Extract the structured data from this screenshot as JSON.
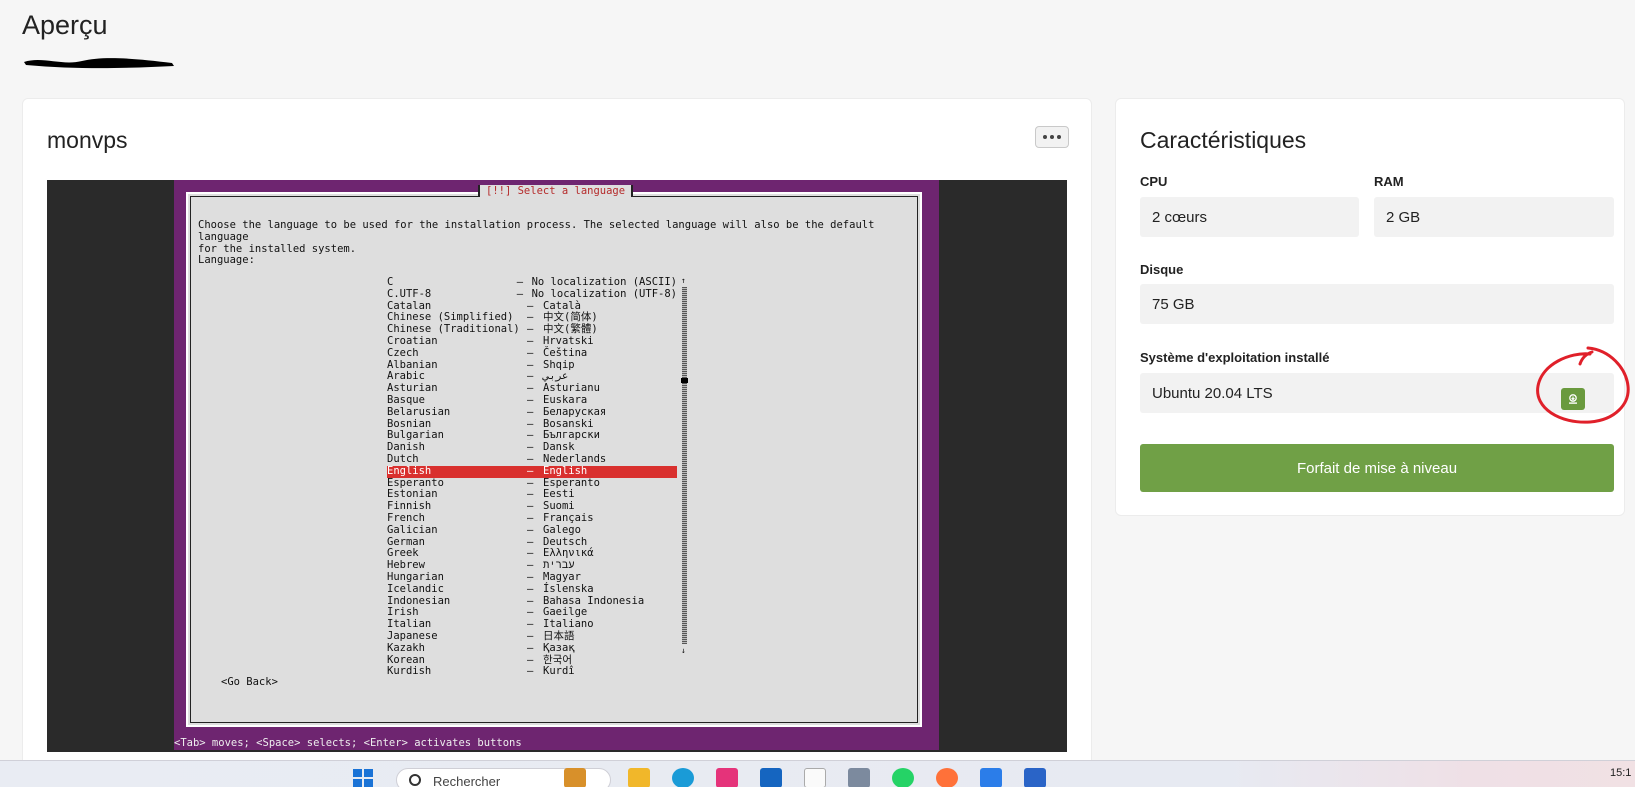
{
  "page": {
    "title": "Aperçu"
  },
  "vps": {
    "name": "monvps",
    "console": {
      "dialog_title": "[!!] Select a language",
      "intro": "Choose the language to be used for the installation process. The selected language will also be the default language\nfor the installed system.",
      "language_label": "Language:",
      "languages": [
        {
          "name": "C",
          "native": "No localization (ASCII)"
        },
        {
          "name": "C.UTF-8",
          "native": "No localization (UTF-8)"
        },
        {
          "name": "Catalan",
          "native": "Català"
        },
        {
          "name": "Chinese (Simplified)",
          "native": "中文(简体)"
        },
        {
          "name": "Chinese (Traditional)",
          "native": "中文(繁體)"
        },
        {
          "name": "Croatian",
          "native": "Hrvatski"
        },
        {
          "name": "Czech",
          "native": "Čeština"
        },
        {
          "name": "Albanian",
          "native": "Shqip"
        },
        {
          "name": "Arabic",
          "native": "عربي"
        },
        {
          "name": "Asturian",
          "native": "Asturianu"
        },
        {
          "name": "Basque",
          "native": "Euskara"
        },
        {
          "name": "Belarusian",
          "native": "Беларуская"
        },
        {
          "name": "Bosnian",
          "native": "Bosanski"
        },
        {
          "name": "Bulgarian",
          "native": "Български"
        },
        {
          "name": "Danish",
          "native": "Dansk"
        },
        {
          "name": "Dutch",
          "native": "Nederlands"
        },
        {
          "name": "English",
          "native": "English",
          "selected": true
        },
        {
          "name": "Esperanto",
          "native": "Esperanto"
        },
        {
          "name": "Estonian",
          "native": "Eesti"
        },
        {
          "name": "Finnish",
          "native": "Suomi"
        },
        {
          "name": "French",
          "native": "Français"
        },
        {
          "name": "Galician",
          "native": "Galego"
        },
        {
          "name": "German",
          "native": "Deutsch"
        },
        {
          "name": "Greek",
          "native": "Ελληνικά"
        },
        {
          "name": "Hebrew",
          "native": "עברית"
        },
        {
          "name": "Hungarian",
          "native": "Magyar"
        },
        {
          "name": "Icelandic",
          "native": "Íslenska"
        },
        {
          "name": "Indonesian",
          "native": "Bahasa Indonesia"
        },
        {
          "name": "Irish",
          "native": "Gaeilge"
        },
        {
          "name": "Italian",
          "native": "Italiano"
        },
        {
          "name": "Japanese",
          "native": "日本語"
        },
        {
          "name": "Kazakh",
          "native": "Қазақ"
        },
        {
          "name": "Korean",
          "native": "한국어"
        },
        {
          "name": "Kurdish",
          "native": "Kurdî"
        }
      ],
      "separator": "–",
      "scroll_up": "↑",
      "scroll_down": "↓",
      "go_back": "<Go Back>",
      "status_line": "<Tab> moves; <Space> selects; <Enter> activates buttons"
    }
  },
  "specs": {
    "title": "Caractéristiques",
    "cpu_label": "CPU",
    "cpu_value": "2 cœurs",
    "ram_label": "RAM",
    "ram_value": "2 GB",
    "disk_label": "Disque",
    "disk_value": "75 GB",
    "os_label": "Système d'exploitation installé",
    "os_value": "Ubuntu 20.04 LTS",
    "upgrade_label": "Forfait de mise à niveau"
  },
  "taskbar": {
    "search_placeholder": "Rechercher",
    "clock": "15:1"
  },
  "colors": {
    "accent_green": "#70a046",
    "installer_purple": "#6e2570",
    "selection_red": "#d9302e",
    "annotation_red": "#e0202a"
  }
}
